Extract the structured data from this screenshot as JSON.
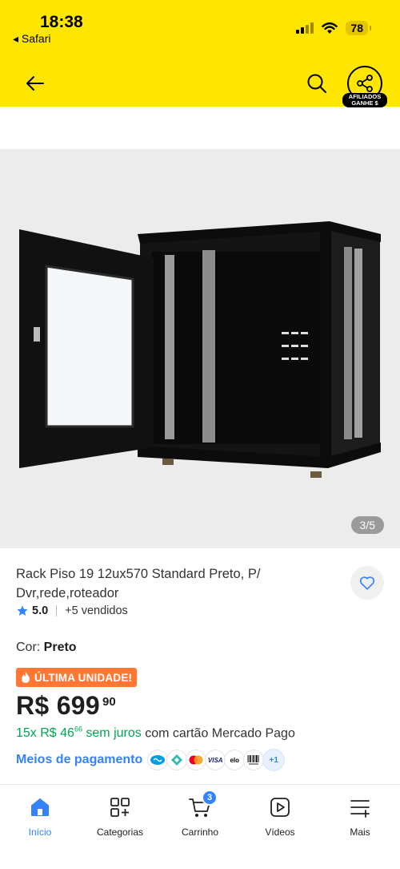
{
  "status_bar": {
    "time": "18:38",
    "back_app": "◂ Safari",
    "battery": "78"
  },
  "header": {
    "share_badge_line1": "AFILIADOS",
    "share_badge_line2": "GANHE $"
  },
  "gallery": {
    "counter": "3/5"
  },
  "product": {
    "title": "Rack Piso 19  12ux570 Standard Preto, P/ Dvr,rede,roteador",
    "rating": "5.0",
    "sold": "+5 vendidos",
    "color_label": "Cor: ",
    "color_value": "Preto",
    "badge": "ÚLTIMA UNIDADE!",
    "price_main": "R$ 699",
    "price_cents": "90",
    "installments_prefix": "15x R$ 46",
    "installments_cents": "66",
    "installments_interest": " sem juros",
    "installments_suffix": " com cartão Mercado Pago",
    "payment_link": "Meios de pagamento",
    "payment_more": "+1",
    "payment_methods": [
      "mercado-pago",
      "pix",
      "mastercard",
      "visa",
      "elo",
      "boleto"
    ]
  },
  "colors": {
    "accent_yellow": "#ffe600",
    "link_blue": "#3483fa",
    "green": "#00a650",
    "orange": "#ff7733"
  },
  "nav": {
    "items": [
      {
        "label": "Início",
        "icon": "home-icon"
      },
      {
        "label": "Categorias",
        "icon": "categories-icon"
      },
      {
        "label": "Carrinho",
        "icon": "cart-icon"
      },
      {
        "label": "Vídeos",
        "icon": "videos-icon"
      },
      {
        "label": "Mais",
        "icon": "more-icon"
      }
    ],
    "cart_count": "3"
  }
}
